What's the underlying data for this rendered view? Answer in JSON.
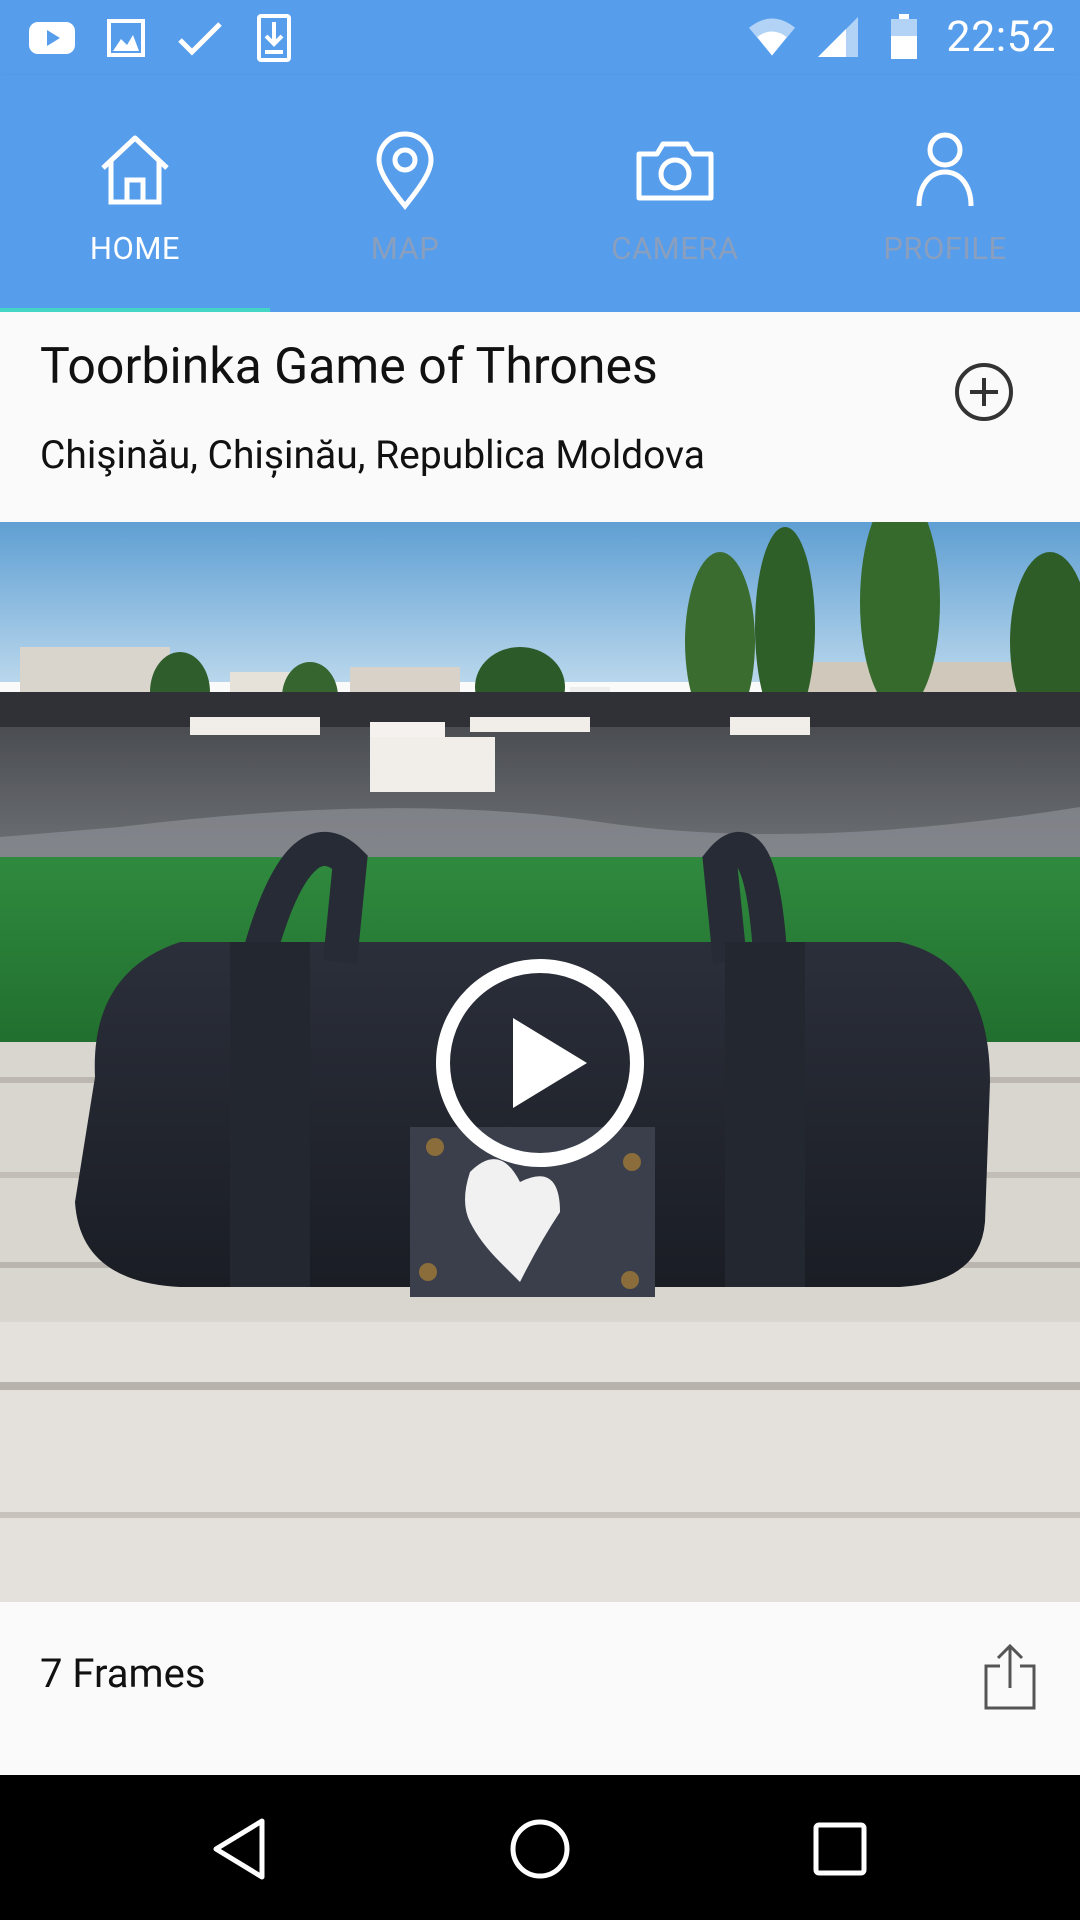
{
  "status_bar": {
    "time": "22:52",
    "left_icons": [
      "youtube-icon",
      "image-icon",
      "check-icon",
      "download-icon"
    ],
    "right_icons": [
      "wifi-icon",
      "signal-icon",
      "battery-icon"
    ]
  },
  "tabs": [
    {
      "label": "HOME",
      "icon": "home-icon",
      "active": true
    },
    {
      "label": "MAP",
      "icon": "map-pin-icon",
      "active": false
    },
    {
      "label": "CAMERA",
      "icon": "camera-icon",
      "active": false
    },
    {
      "label": "PROFILE",
      "icon": "profile-icon",
      "active": false
    }
  ],
  "post": {
    "title": "Toorbinka Game of Thrones",
    "location": "Chişinău, Chișinău, Republica Moldova",
    "frames_label": "7 Frames"
  },
  "colors": {
    "accent": "#569dec",
    "tab_indicator": "#43d6c4",
    "inactive_tab": "#8a9fbd"
  },
  "nav_bar": [
    "back-icon",
    "home-circle-icon",
    "recents-icon"
  ]
}
